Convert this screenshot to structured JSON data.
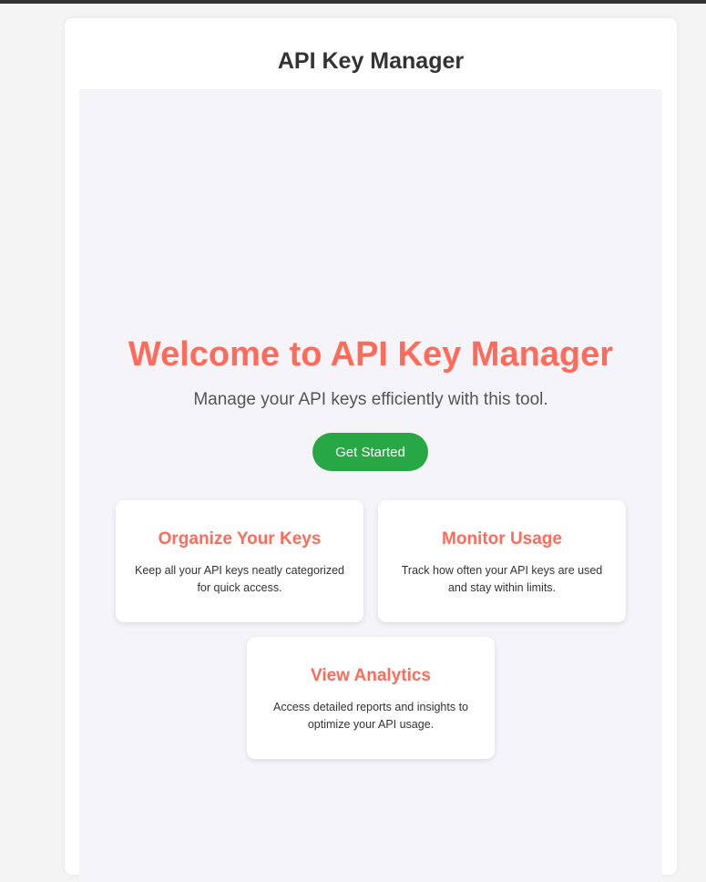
{
  "header": {
    "title": "API Key Manager"
  },
  "hero": {
    "title": "Welcome to API Key Manager",
    "subtitle": "Manage your API keys efficiently with this tool.",
    "cta_label": "Get Started"
  },
  "features": [
    {
      "title": "Organize Your Keys",
      "description": "Keep all your API keys neatly categorized for quick access."
    },
    {
      "title": "Monitor Usage",
      "description": "Track how often your API keys are used and stay within limits."
    },
    {
      "title": "View Analytics",
      "description": "Access detailed reports and insights to optimize your API usage."
    }
  ],
  "colors": {
    "accent": "#ff6b5b",
    "cta": "#28a745",
    "panel_background": "#f4f4f9",
    "page_background": "#f4f4f4",
    "title_text": "#333333"
  }
}
